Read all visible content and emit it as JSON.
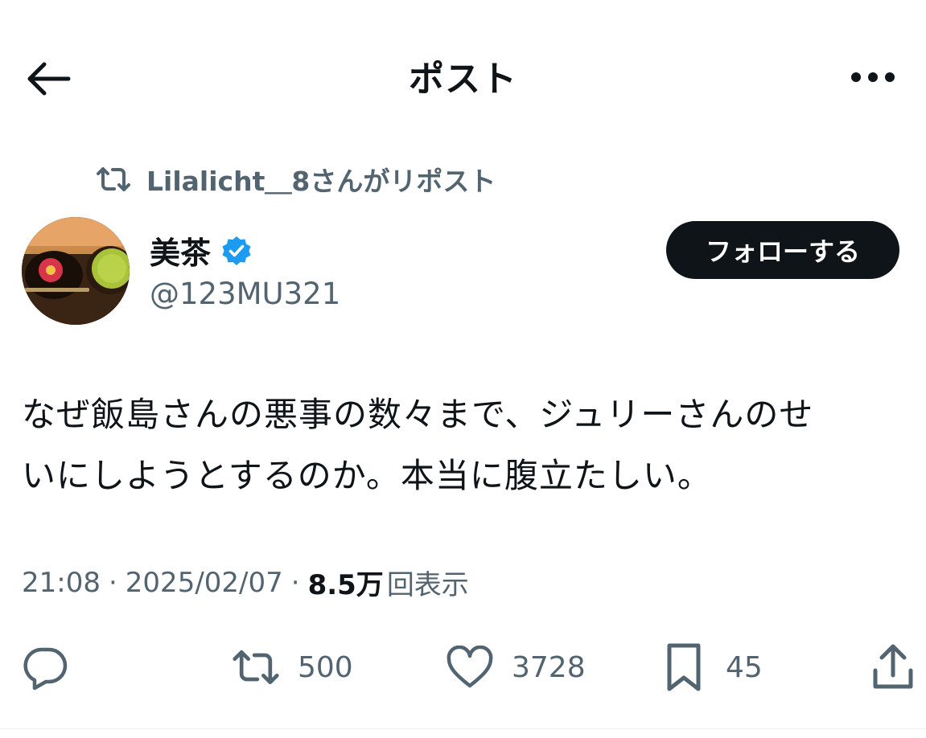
{
  "header": {
    "title": "ポスト"
  },
  "repost": {
    "text": "Lilalicht＿8さんがリポスト"
  },
  "author": {
    "display_name": "美茶",
    "handle": "@123MU321",
    "verified": true,
    "follow_label": "フォローする"
  },
  "post": {
    "line1": "なぜ飯島さんの悪事の数々まで、ジュリーさんのせ",
    "line2": "いにしようとするのか。本当に腹立たしい。"
  },
  "meta": {
    "time": "21:08",
    "date": "2025/02/07",
    "views_count": "8.5万",
    "views_label": "回表示"
  },
  "actions": {
    "reply_count": "",
    "repost_count": "500",
    "like_count": "3728",
    "bookmark_count": "45"
  },
  "colors": {
    "text_primary": "#0f1419",
    "text_secondary": "#536471",
    "verified_blue": "#1d9bf0",
    "follow_bg": "#0f1419"
  },
  "icons": {
    "back": "arrow-left-icon",
    "more": "more-horizontal-icon",
    "repost": "repost-icon",
    "verified": "verified-badge-icon",
    "reply": "reply-icon",
    "like": "heart-icon",
    "bookmark": "bookmark-icon",
    "share": "share-icon"
  }
}
